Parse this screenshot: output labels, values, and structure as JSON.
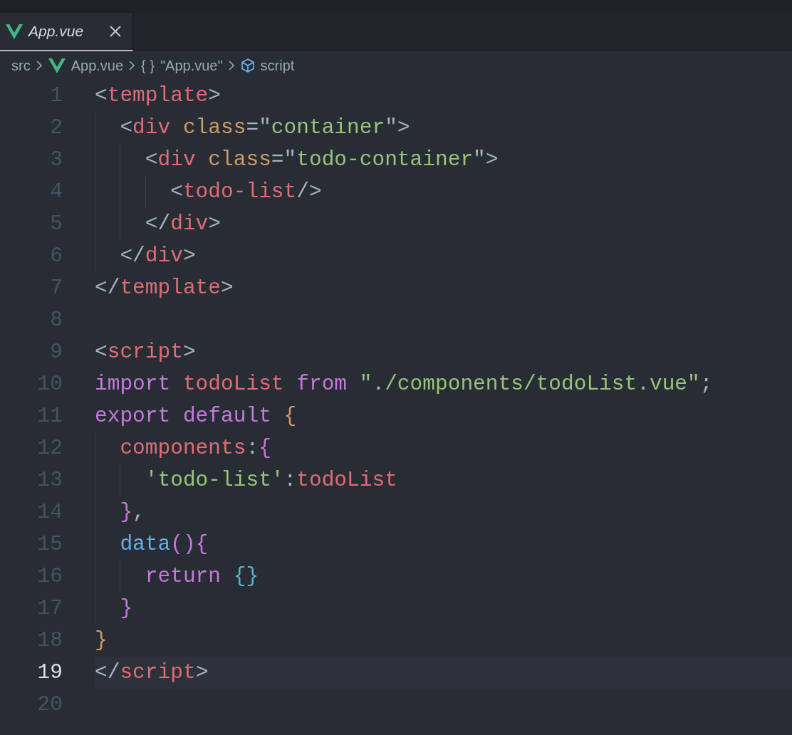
{
  "tabs": [
    {
      "label": "App.vue",
      "selected": true,
      "preview": true
    }
  ],
  "breadcrumb": [
    {
      "label": "src",
      "kind": "folder"
    },
    {
      "label": "App.vue",
      "kind": "vue"
    },
    {
      "label": "\"App.vue\"",
      "kind": "module",
      "glyph": "{ }"
    },
    {
      "label": "script",
      "kind": "element"
    }
  ],
  "lines": [
    {
      "number": "1",
      "selected": false,
      "tokens": [
        {
          "text": "<",
          "kind": "punct"
        },
        {
          "text": "template",
          "kind": "tag"
        },
        {
          "text": ">",
          "kind": "punct"
        }
      ]
    },
    {
      "number": "2",
      "selected": false,
      "tokens": [
        {
          "text": "  <",
          "kind": "punct"
        },
        {
          "text": "div",
          "kind": "tag"
        },
        {
          "text": " class",
          "kind": "attr"
        },
        {
          "text": "=\"",
          "kind": "punct"
        },
        {
          "text": "container",
          "kind": "string"
        },
        {
          "text": "\">",
          "kind": "punct"
        }
      ]
    },
    {
      "number": "3",
      "selected": false,
      "tokens": [
        {
          "text": "    <",
          "kind": "punct"
        },
        {
          "text": "div",
          "kind": "tag"
        },
        {
          "text": " class",
          "kind": "attr"
        },
        {
          "text": "=\"",
          "kind": "punct"
        },
        {
          "text": "todo-container",
          "kind": "string"
        },
        {
          "text": "\">",
          "kind": "punct"
        }
      ]
    },
    {
      "number": "4",
      "selected": false,
      "tokens": [
        {
          "text": "      <",
          "kind": "punct"
        },
        {
          "text": "todo-list",
          "kind": "tag"
        },
        {
          "text": "/>",
          "kind": "punct"
        }
      ]
    },
    {
      "number": "5",
      "selected": false,
      "tokens": [
        {
          "text": "    </",
          "kind": "punct"
        },
        {
          "text": "div",
          "kind": "tag"
        },
        {
          "text": ">",
          "kind": "punct"
        }
      ]
    },
    {
      "number": "6",
      "selected": false,
      "tokens": [
        {
          "text": "  </",
          "kind": "punct"
        },
        {
          "text": "div",
          "kind": "tag"
        },
        {
          "text": ">",
          "kind": "punct"
        }
      ]
    },
    {
      "number": "7",
      "selected": false,
      "tokens": [
        {
          "text": "</",
          "kind": "punct"
        },
        {
          "text": "template",
          "kind": "tag"
        },
        {
          "text": ">",
          "kind": "punct"
        }
      ]
    },
    {
      "number": "8",
      "selected": false
    },
    {
      "number": "9",
      "selected": false,
      "tokens": [
        {
          "text": "<",
          "kind": "punct"
        },
        {
          "text": "script",
          "kind": "tag"
        },
        {
          "text": ">",
          "kind": "punct"
        }
      ]
    },
    {
      "number": "10",
      "selected": false,
      "tokens": [
        {
          "text": "import ",
          "kind": "keyword"
        },
        {
          "text": "todoList",
          "kind": "variable"
        },
        {
          "text": " from ",
          "kind": "keyword"
        },
        {
          "text": "\"./components/todoList.vue\"",
          "kind": "string"
        },
        {
          "text": ";",
          "kind": "punct"
        }
      ]
    },
    {
      "number": "11",
      "selected": false,
      "tokens": [
        {
          "text": "export default ",
          "kind": "keyword"
        },
        {
          "text": "{",
          "kind": "bracket1"
        }
      ]
    },
    {
      "number": "12",
      "selected": false,
      "tokens": [
        {
          "text": "  components",
          "kind": "variable"
        },
        {
          "text": ":",
          "kind": "punct"
        },
        {
          "text": "{",
          "kind": "bracket2"
        }
      ]
    },
    {
      "number": "13",
      "selected": false,
      "tokens": [
        {
          "text": "    'todo-list'",
          "kind": "string"
        },
        {
          "text": ":",
          "kind": "punct"
        },
        {
          "text": "todoList",
          "kind": "variable"
        }
      ]
    },
    {
      "number": "14",
      "selected": false,
      "tokens": [
        {
          "text": "  }",
          "kind": "bracket2"
        },
        {
          "text": ",",
          "kind": "punct"
        }
      ]
    },
    {
      "number": "15",
      "selected": false,
      "tokens": [
        {
          "text": "  data",
          "kind": "function"
        },
        {
          "text": "(){",
          "kind": "bracket2"
        }
      ]
    },
    {
      "number": "16",
      "selected": false,
      "tokens": [
        {
          "text": "    return ",
          "kind": "keyword"
        },
        {
          "text": "{}",
          "kind": "bracket3"
        }
      ]
    },
    {
      "number": "17",
      "selected": false,
      "tokens": [
        {
          "text": "  }",
          "kind": "bracket2"
        }
      ]
    },
    {
      "number": "18",
      "selected": false,
      "tokens": [
        {
          "text": "}",
          "kind": "bracket1"
        }
      ]
    },
    {
      "number": "19",
      "selected": true,
      "tokens": [
        {
          "text": "</",
          "kind": "punct"
        },
        {
          "text": "script",
          "kind": "tag"
        },
        {
          "text": ">",
          "kind": "punct"
        }
      ]
    },
    {
      "number": "20",
      "selected": false
    }
  ]
}
